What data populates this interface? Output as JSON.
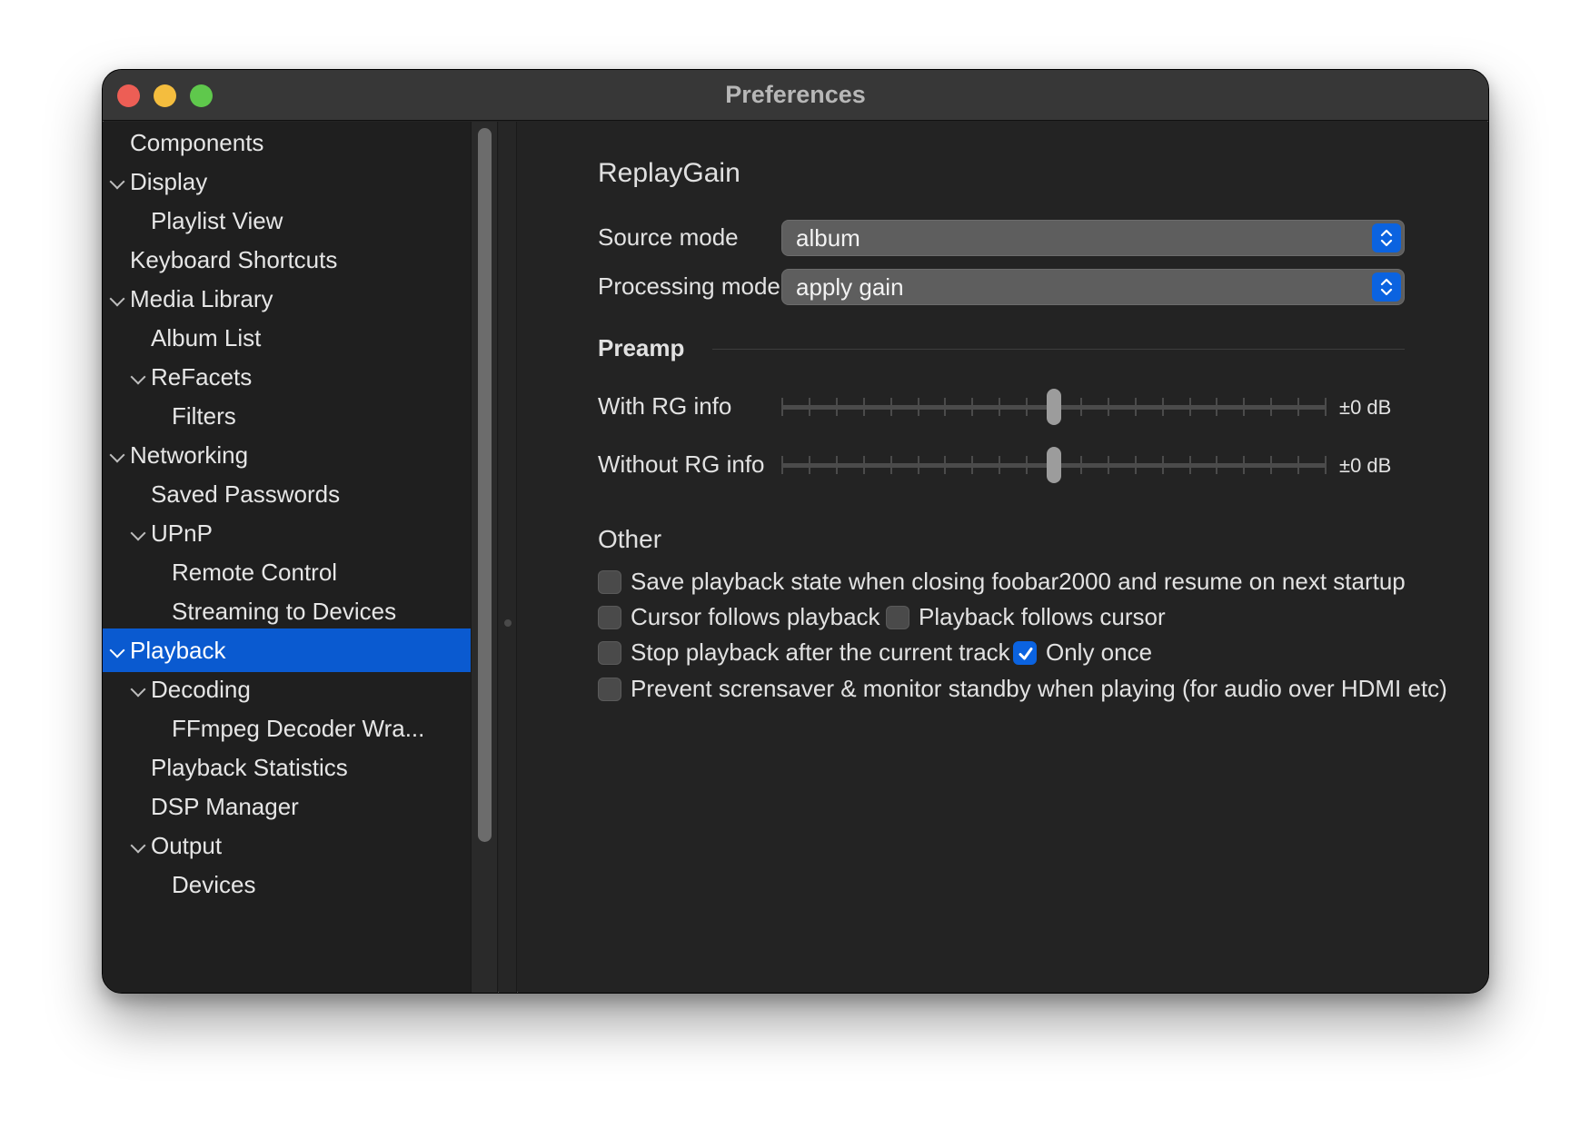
{
  "window": {
    "title": "Preferences"
  },
  "sidebar": {
    "items": [
      {
        "label": "Components",
        "level": 0,
        "expandable": false,
        "selected": false
      },
      {
        "label": "Display",
        "level": 0,
        "expandable": true,
        "selected": false
      },
      {
        "label": "Playlist View",
        "level": 1,
        "expandable": false,
        "selected": false
      },
      {
        "label": "Keyboard Shortcuts",
        "level": 0,
        "expandable": false,
        "selected": false
      },
      {
        "label": "Media Library",
        "level": 0,
        "expandable": true,
        "selected": false
      },
      {
        "label": "Album List",
        "level": 1,
        "expandable": false,
        "selected": false
      },
      {
        "label": "ReFacets",
        "level": 1,
        "expandable": true,
        "selected": false
      },
      {
        "label": "Filters",
        "level": 2,
        "expandable": false,
        "selected": false
      },
      {
        "label": "Networking",
        "level": 0,
        "expandable": true,
        "selected": false
      },
      {
        "label": "Saved Passwords",
        "level": 1,
        "expandable": false,
        "selected": false
      },
      {
        "label": "UPnP",
        "level": 1,
        "expandable": true,
        "selected": false
      },
      {
        "label": "Remote Control",
        "level": 2,
        "expandable": false,
        "selected": false
      },
      {
        "label": "Streaming to Devices",
        "level": 2,
        "expandable": false,
        "selected": false
      },
      {
        "label": "Playback",
        "level": 0,
        "expandable": true,
        "selected": true
      },
      {
        "label": "Decoding",
        "level": 1,
        "expandable": true,
        "selected": false
      },
      {
        "label": "FFmpeg Decoder Wra...",
        "level": 2,
        "expandable": false,
        "selected": false
      },
      {
        "label": "Playback Statistics",
        "level": 1,
        "expandable": false,
        "selected": false
      },
      {
        "label": "DSP Manager",
        "level": 1,
        "expandable": false,
        "selected": false
      },
      {
        "label": "Output",
        "level": 1,
        "expandable": true,
        "selected": false
      },
      {
        "label": "Devices",
        "level": 2,
        "expandable": false,
        "selected": false
      }
    ]
  },
  "replaygain": {
    "heading": "ReplayGain",
    "source_mode_label": "Source mode",
    "source_mode_value": "album",
    "processing_mode_label": "Processing mode",
    "processing_mode_value": "apply gain"
  },
  "preamp": {
    "heading": "Preamp",
    "with_rg_label": "With RG info",
    "with_rg_value": "±0 dB",
    "with_rg_level": 0.5,
    "without_rg_label": "Without RG info",
    "without_rg_value": "±0 dB",
    "without_rg_level": 0.5
  },
  "other": {
    "heading": "Other",
    "save_state_label": "Save playback state when closing foobar2000 and resume on next startup",
    "save_state_checked": false,
    "cursor_follows_label": "Cursor follows playback",
    "cursor_follows_checked": false,
    "playback_follows_label": "Playback follows cursor",
    "playback_follows_checked": false,
    "stop_after_label": "Stop playback after the current track",
    "stop_after_checked": false,
    "only_once_label": "Only once",
    "only_once_checked": true,
    "prevent_screensaver_label": "Prevent scrensaver & monitor standby when playing (for audio over HDMI etc)",
    "prevent_screensaver_checked": false
  },
  "colors": {
    "accent": "#0a5ad0",
    "window_bg": "#232323",
    "sidebar_bg": "#1f1f1f"
  }
}
